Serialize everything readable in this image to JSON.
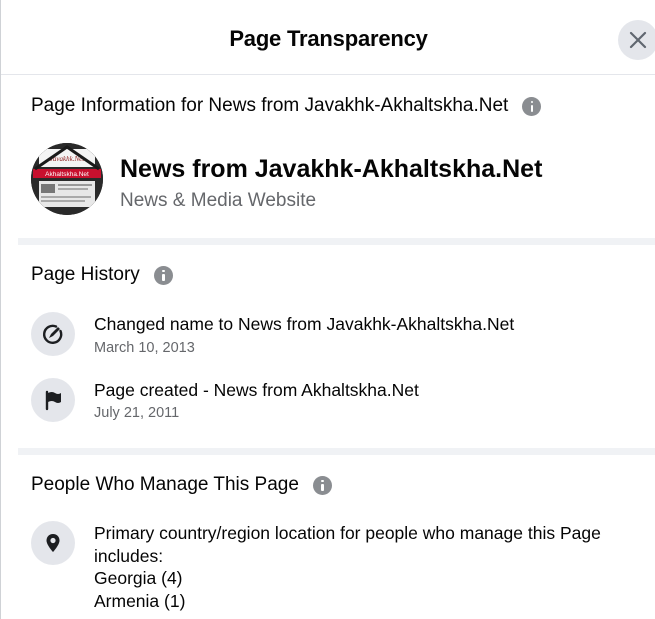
{
  "dialog": {
    "title": "Page Transparency",
    "close_icon": "close-icon"
  },
  "page_info": {
    "heading": "Page Information for News from Javakhk-Akhaltskha.Net",
    "name": "News from Javakhk-Akhaltskha.Net",
    "category": "News & Media Website",
    "avatar_banner_text": "Akhaltskha.Net",
    "avatar_logo_text": "Javakhk.Net"
  },
  "page_history": {
    "heading": "Page History",
    "items": [
      {
        "icon": "name-change-icon",
        "title": "Changed name to News from Javakhk-Akhaltskha.Net",
        "date": "March 10, 2013"
      },
      {
        "icon": "flag-icon",
        "title": "Page created - News from Akhaltskha.Net",
        "date": "July 21, 2011"
      }
    ]
  },
  "managers": {
    "heading": "People Who Manage This Page",
    "icon": "location-pin-icon",
    "location_line1": "Primary country/region location for people who manage this Page",
    "location_line2": "includes:",
    "countries": [
      "Georgia (4)",
      "Armenia (1)"
    ]
  },
  "colors": {
    "text_primary": "#050505",
    "text_secondary": "#65676b",
    "icon_bg": "#e4e6eb",
    "info_icon": "#8a8d91",
    "divider": "#f0f2f5"
  }
}
